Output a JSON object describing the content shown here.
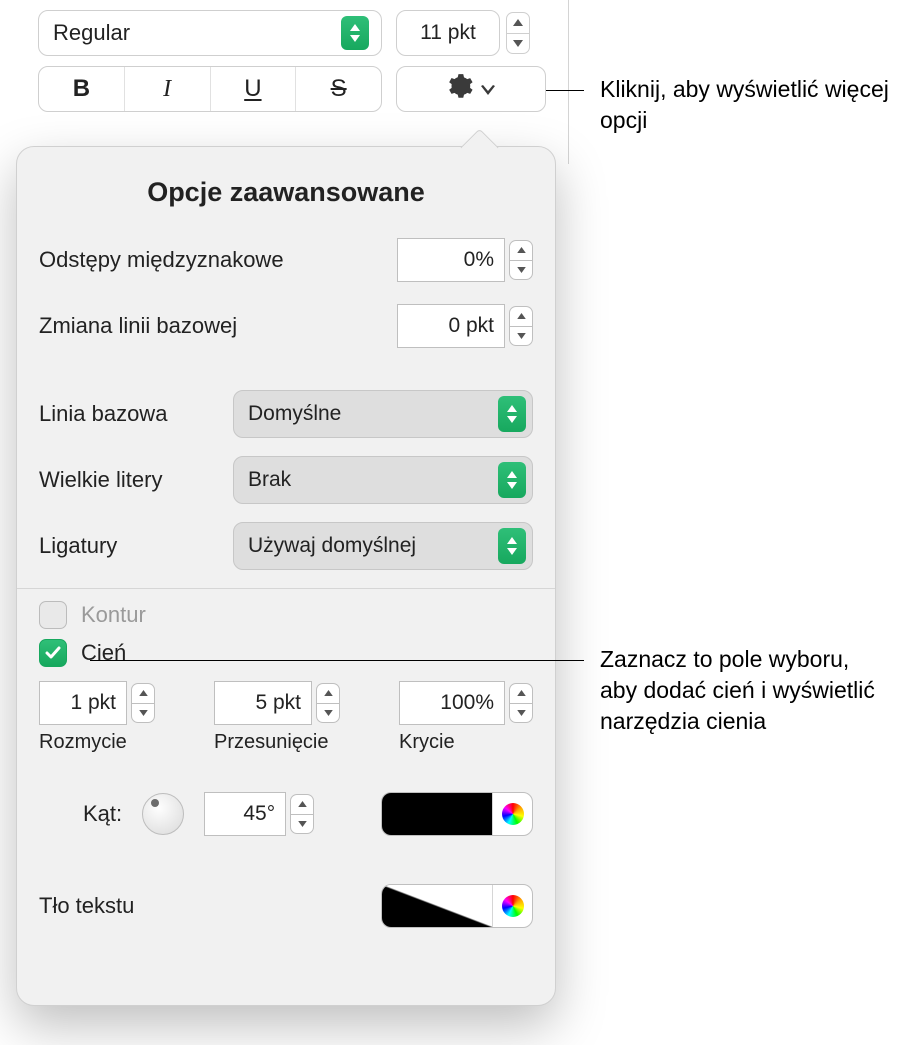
{
  "top": {
    "font_style": "Regular",
    "font_size": "11 pkt",
    "bold": "B",
    "italic": "I",
    "underline": "U",
    "strike": "S"
  },
  "popover": {
    "title": "Opcje zaawansowane",
    "char_spacing_label": "Odstępy międzyznakowe",
    "char_spacing_value": "0%",
    "baseline_shift_label": "Zmiana linii bazowej",
    "baseline_shift_value": "0 pkt",
    "baseline_label": "Linia bazowa",
    "baseline_value": "Domyślne",
    "caps_label": "Wielkie litery",
    "caps_value": "Brak",
    "ligatures_label": "Ligatury",
    "ligatures_value": "Używaj domyślnej",
    "outline_label": "Kontur",
    "outline_checked": false,
    "shadow_label": "Cień",
    "shadow_checked": true,
    "blur_value": "1 pkt",
    "blur_label": "Rozmycie",
    "offset_value": "5 pkt",
    "offset_label": "Przesunięcie",
    "opacity_value": "100%",
    "opacity_label": "Krycie",
    "angle_label": "Kąt:",
    "angle_value": "45°",
    "text_bg_label": "Tło tekstu"
  },
  "callouts": {
    "gear": "Kliknij, aby wyświetlić więcej opcji",
    "shadow": "Zaznacz to pole wyboru, aby dodać cień i wyświetlić narzędzia cienia"
  }
}
